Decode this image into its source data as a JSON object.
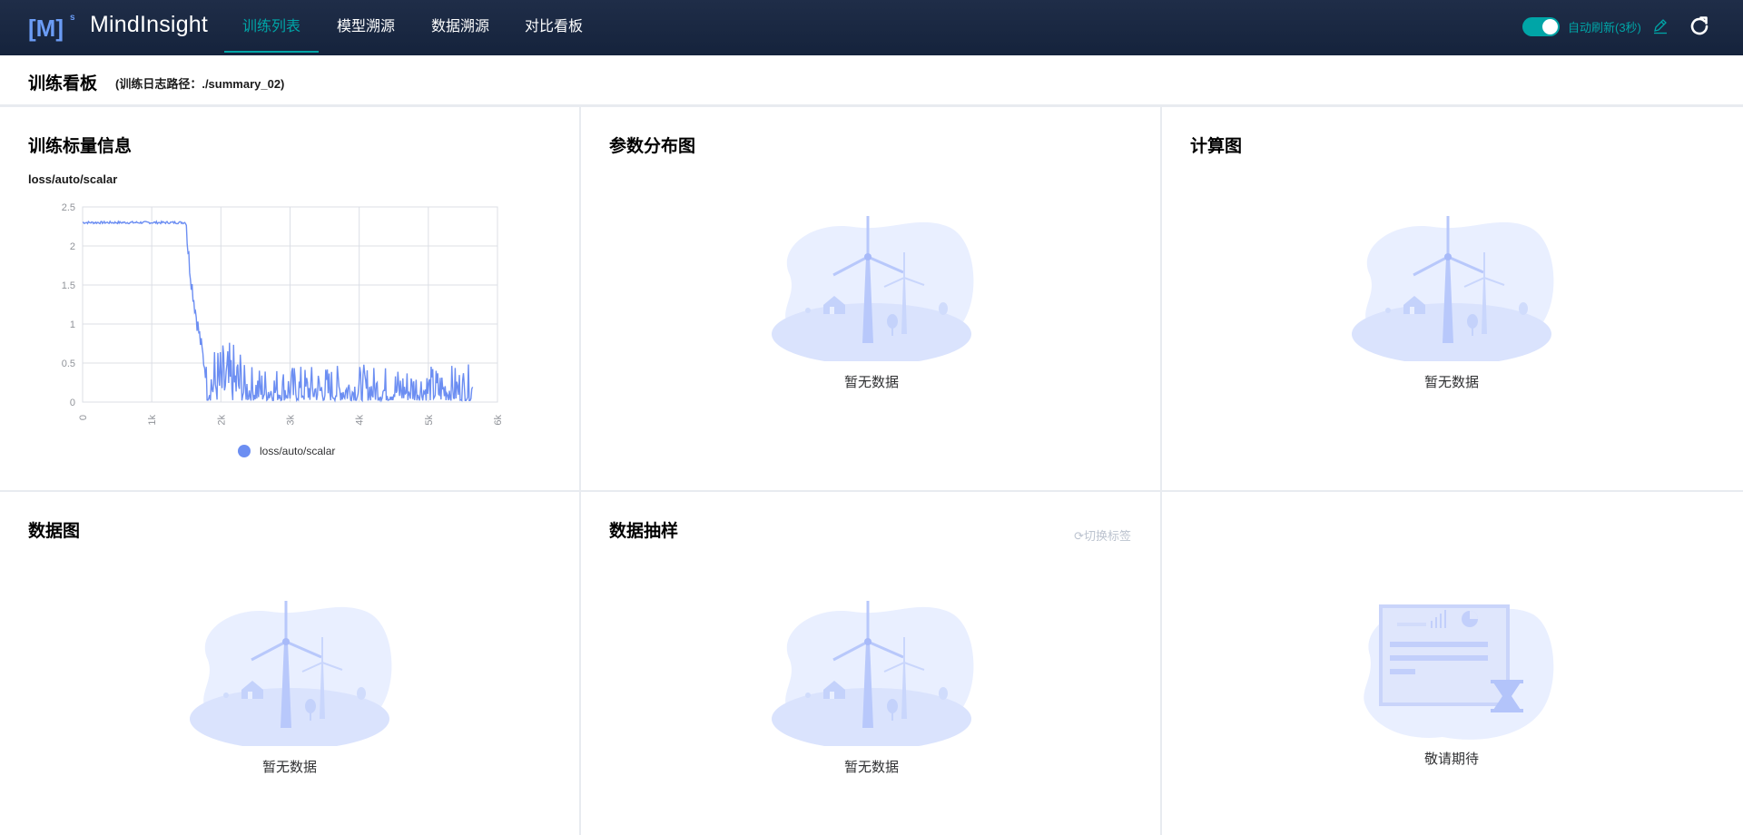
{
  "header": {
    "logo_text": "[M]",
    "logo_sup": "s",
    "brand": "MindInsight",
    "nav": [
      {
        "label": "训练列表",
        "active": true
      },
      {
        "label": "模型溯源",
        "active": false
      },
      {
        "label": "数据溯源",
        "active": false
      },
      {
        "label": "对比看板",
        "active": false
      }
    ],
    "auto_refresh_label": "自动刷新(3秒)",
    "auto_refresh_on": true,
    "accent": "#00a5a7"
  },
  "page": {
    "title": "训练看板",
    "path": "(训练日志路径：./summary_02)"
  },
  "cards": {
    "scalar": {
      "title": "训练标量信息",
      "tag": "loss/auto/scalar"
    },
    "histogram": {
      "title": "参数分布图",
      "empty": "暂无数据"
    },
    "graph": {
      "title": "计算图",
      "empty": "暂无数据"
    },
    "dataset_graph": {
      "title": "数据图",
      "empty": "暂无数据"
    },
    "image": {
      "title": "数据抽样",
      "empty": "暂无数据",
      "switch_label": "切换标签"
    },
    "coming": {
      "text": "敬请期待"
    }
  },
  "chart_data": {
    "type": "line",
    "title": "loss/auto/scalar",
    "series": [
      {
        "name": "loss/auto/scalar",
        "color": "#6c8ef2"
      }
    ],
    "x_ticks": [
      "0",
      "1k",
      "2k",
      "3k",
      "4k",
      "5k",
      "6k"
    ],
    "y_ticks": [
      "0",
      "0.5",
      "1",
      "1.5",
      "2",
      "2.5"
    ],
    "xlim": [
      0,
      6000
    ],
    "ylim": [
      0,
      2.5
    ],
    "grid": true,
    "legend": "bottom",
    "approx_shape": {
      "plateau": {
        "x": [
          0,
          1500
        ],
        "y": 2.3
      },
      "drop": {
        "x": [
          1500,
          1800
        ],
        "y": [
          2.3,
          0.3
        ]
      },
      "tail": {
        "x": [
          1800,
          5650
        ],
        "y_range": [
          0.02,
          0.6
        ]
      }
    }
  }
}
